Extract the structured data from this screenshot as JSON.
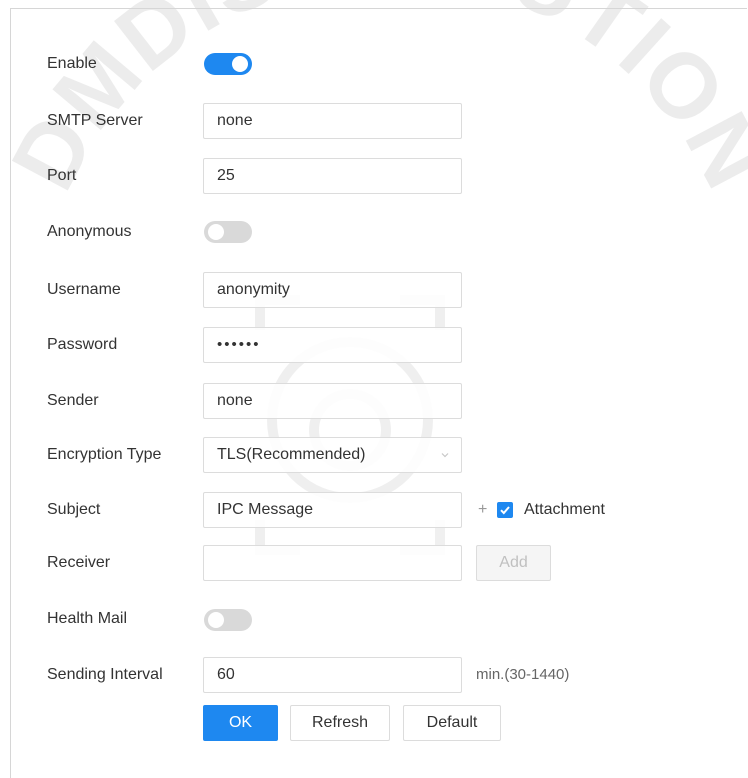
{
  "form": {
    "enable": {
      "label": "Enable",
      "on": true
    },
    "smtp_server": {
      "label": "SMTP Server",
      "value": "none"
    },
    "port": {
      "label": "Port",
      "value": "25"
    },
    "anonymous": {
      "label": "Anonymous",
      "on": false
    },
    "username": {
      "label": "Username",
      "value": "anonymity"
    },
    "password": {
      "label": "Password",
      "value": "••••••"
    },
    "sender": {
      "label": "Sender",
      "value": "none"
    },
    "encryption": {
      "label": "Encryption Type",
      "value": "TLS(Recommended)"
    },
    "subject": {
      "label": "Subject",
      "value": "IPC Message",
      "plus": "+",
      "attachment_label": "Attachment",
      "attachment_checked": true
    },
    "receiver": {
      "label": "Receiver",
      "value": "",
      "add_label": "Add"
    },
    "health_mail": {
      "label": "Health Mail",
      "on": false
    },
    "sending_interval": {
      "label": "Sending Interval",
      "value": "60",
      "unit": "min.(30-1440)"
    }
  },
  "buttons": {
    "ok": "OK",
    "refresh": "Refresh",
    "default": "Default"
  },
  "watermark": {
    "text": "DMDISTRIBUTION"
  },
  "colors": {
    "accent": "#1e88f0",
    "toggle_off": "#d9d9d9",
    "text": "#333333"
  }
}
